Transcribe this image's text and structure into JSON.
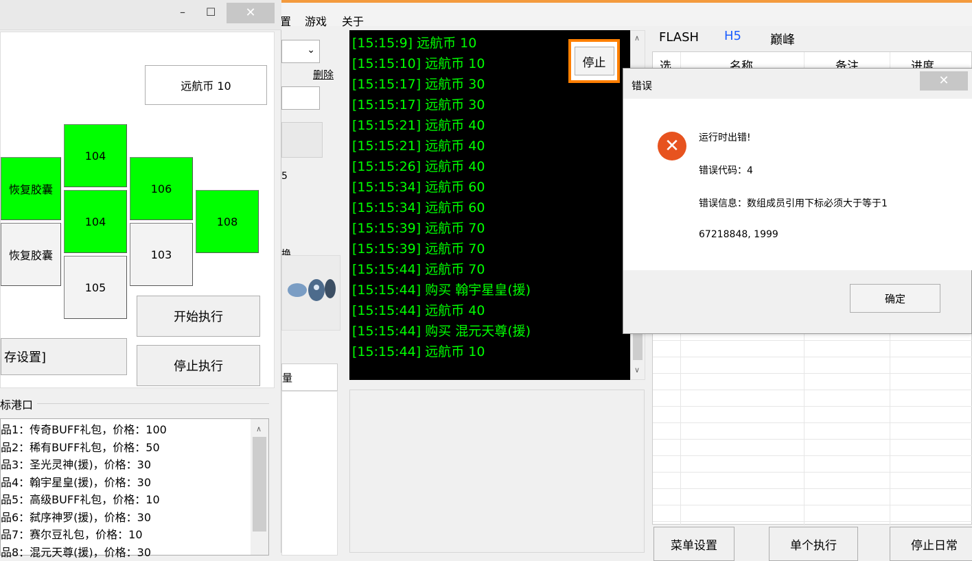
{
  "menu": {
    "items": [
      "置",
      "游戏",
      "关于"
    ]
  },
  "left_window": {
    "controls": {
      "minimize": "–",
      "maximize": "☐",
      "close": "✕"
    },
    "top_button": "远航币 10",
    "cells": {
      "c1": "104",
      "c2": "恢复胶囊",
      "c3": "106",
      "c4": "104",
      "c5": "108",
      "c6": "恢复胶囊",
      "c7": "103",
      "c8": "105"
    },
    "save_button": "存设置]",
    "start_button": "开始执行",
    "stop_button": "停止执行",
    "section_label": "标港口",
    "list_items": [
      "品1：传奇BUFF礼包，价格：100",
      "品2：稀有BUFF礼包，价格：50",
      "品3：圣光灵神(援)，价格：30",
      "品4：翰宇星皇(援)，价格：30",
      "品5：高级BUFF礼包，价格：10",
      "品6：弑序神罗(援)，价格：30",
      "品7：赛尔豆礼包，价格：10",
      "品8：混元天尊(援)，价格：30"
    ]
  },
  "middle": {
    "delete_link": "删除",
    "char_5": "5",
    "char_liang": "量",
    "char_mian": "换"
  },
  "console": {
    "stop_label": "停止",
    "lines": [
      "[15:15:9] 远航币 10",
      "[15:15:10] 远航币 10",
      "[15:15:17] 远航币 30",
      "[15:15:17] 远航币 30",
      "[15:15:21] 远航币 40",
      "[15:15:21] 远航币 40",
      "[15:15:26] 远航币 40",
      "[15:15:34] 远航币 60",
      "[15:15:34] 远航币 60",
      "[15:15:39] 远航币 70",
      "[15:15:39] 远航币 70",
      "[15:15:44] 远航币 70",
      "[15:15:44] 购买 翰宇星皇(援)",
      "[15:15:44] 远航币 40",
      "[15:15:44] 购买 混元天尊(援)",
      "[15:15:44] 远航币 10"
    ]
  },
  "right_panel": {
    "tabs": [
      "FLASH",
      "H5",
      "巅峰"
    ],
    "columns": [
      "选",
      "名称",
      "备注",
      "进度"
    ],
    "buttons": [
      "菜单设置",
      "单个执行",
      "停止日常"
    ]
  },
  "dialog": {
    "title": "错误",
    "close": "✕",
    "icon": "error-icon",
    "line1": "运行时出错!",
    "line2": "错误代码：4",
    "line3": "错误信息：数组成员引用下标必须大于等于1",
    "line4": "67218848, 1999",
    "ok": "确定"
  },
  "colors": {
    "accent_orange": "#f39a3d",
    "console_text": "#00ff00",
    "cell_green": "#00ff00",
    "error_red": "#e7531f"
  }
}
